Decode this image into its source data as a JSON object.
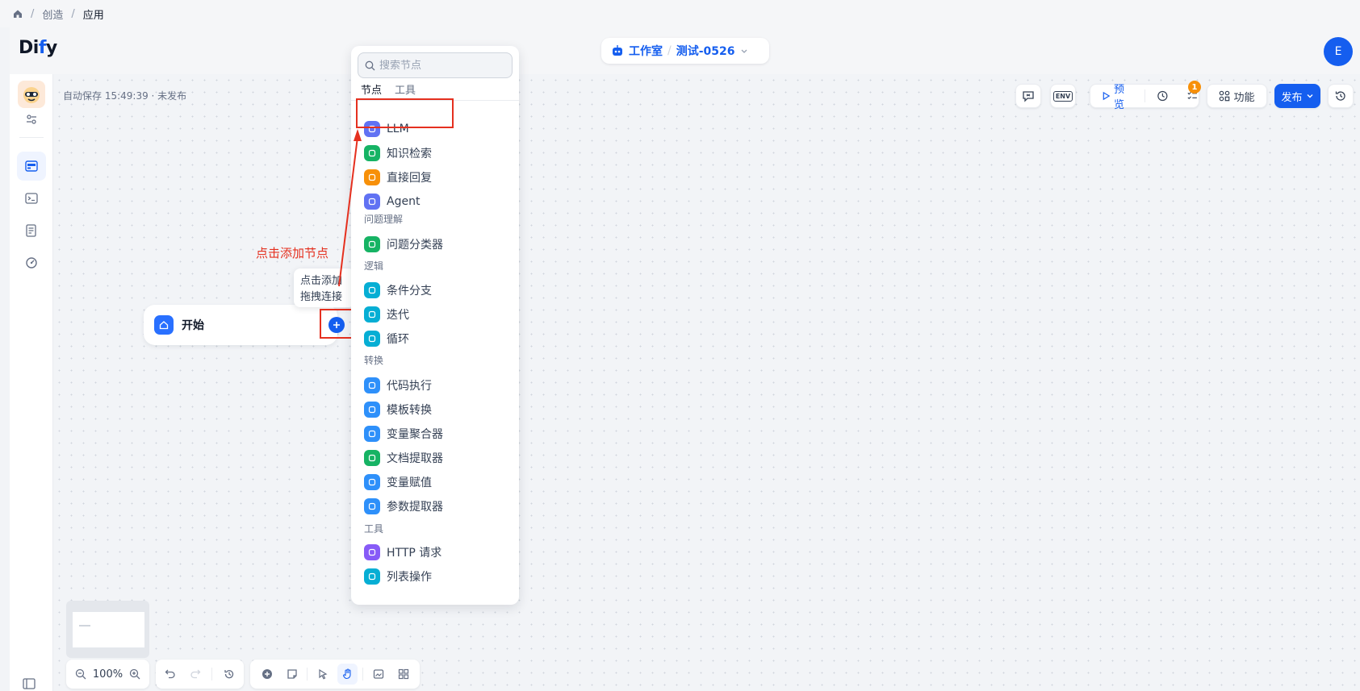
{
  "breadcrumb": {
    "items": [
      "创造",
      "应用"
    ],
    "separator": "/"
  },
  "header": {
    "logo": "Dify",
    "app_type": "工作室",
    "app_name": "测试-0526",
    "avatar_initial": "E"
  },
  "canvas": {
    "autosave": "自动保存 15:49:39 · 未发布",
    "start_node": "开始",
    "tooltip": [
      "点击添加",
      "拖拽连接"
    ],
    "annotation": "点击添加节点"
  },
  "toolbar": {
    "env": "ENV",
    "preview": "预览",
    "checklist_badge": "1",
    "features": "功能",
    "publish": "发布"
  },
  "node_panel": {
    "search_placeholder": "搜索节点",
    "tabs": [
      "节点",
      "工具"
    ],
    "categories": {
      "question": "问题理解",
      "logic": "逻辑",
      "transform": "转换",
      "tools": "工具"
    },
    "items": {
      "llm": "LLM",
      "knowledge": "知识检索",
      "answer": "直接回复",
      "agent": "Agent",
      "classifier": "问题分类器",
      "if_else": "条件分支",
      "iteration": "迭代",
      "loop": "循环",
      "code": "代码执行",
      "template": "模板转换",
      "var_agg": "变量聚合器",
      "doc_extract": "文档提取器",
      "var_assign": "变量赋值",
      "param_extract": "参数提取器",
      "http": "HTTP 请求",
      "list_op": "列表操作"
    },
    "icon_colors": {
      "llm": "#6172f3",
      "knowledge": "#16b364",
      "answer": "#f79009",
      "agent": "#6172f3",
      "classifier": "#16b364",
      "if_else": "#06aed4",
      "iteration": "#06aed4",
      "loop": "#06aed4",
      "code": "#2e90fa",
      "template": "#2e90fa",
      "var_agg": "#2e90fa",
      "doc_extract": "#16b364",
      "var_assign": "#2e90fa",
      "param_extract": "#2e90fa",
      "http": "#875bf7",
      "list_op": "#06aed4"
    }
  },
  "bottom": {
    "zoom": "100%"
  },
  "colors": {
    "primary": "#155eef",
    "annotation": "#e5301f"
  }
}
